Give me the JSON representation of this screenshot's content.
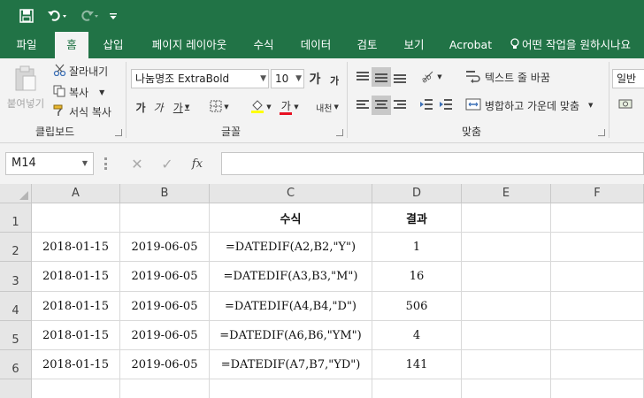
{
  "titlebar": {
    "save_icon": "save-icon",
    "undo_icon": "undo-icon",
    "redo_icon": "redo-icon",
    "customize_icon": "customize-quick-access-icon",
    "bg_color": "#217346"
  },
  "tabs": [
    {
      "label": "파일"
    },
    {
      "label": "홈"
    },
    {
      "label": "삽입"
    },
    {
      "label": "페이지 레이아웃"
    },
    {
      "label": "수식"
    },
    {
      "label": "데이터"
    },
    {
      "label": "검토"
    },
    {
      "label": "보기"
    },
    {
      "label": "Acrobat"
    },
    {
      "label": "어떤 작업을 원하시나요"
    }
  ],
  "active_tab": "홈",
  "ribbon": {
    "clipboard": {
      "paste_label": "붙여넣기",
      "cut_label": "잘라내기",
      "copy_label": "복사",
      "format_painter_label": "서식 복사",
      "group_label": "클립보드"
    },
    "font": {
      "font_name": "나눔명조 ExtraBold",
      "font_size": "10",
      "bold_label": "가",
      "italic_label": "가",
      "underline_label": "가",
      "grow_label": "가",
      "shrink_label": "가",
      "color_label": "가",
      "phonetic_label": "내천",
      "group_label": "글꼴"
    },
    "alignment": {
      "wrap_text_label": "텍스트 줄 바꿈",
      "merge_center_label": "병합하고 가운데 맞춤",
      "group_label": "맞춤"
    },
    "number": {
      "format_value": "일반"
    }
  },
  "formula_bar": {
    "name_box": "M14",
    "cancel_icon": "cancel-icon",
    "enter_icon": "check-icon",
    "fx_label": "fx",
    "formula": ""
  },
  "sheet": {
    "columns": [
      "A",
      "B",
      "C",
      "D",
      "E",
      "F"
    ],
    "rows": [
      {
        "num": "1",
        "cells": [
          "",
          "",
          "수식",
          "결과",
          "",
          ""
        ]
      },
      {
        "num": "2",
        "cells": [
          "2018-01-15",
          "2019-06-05",
          "=DATEDIF(A2,B2,\"Y\")",
          "1",
          "",
          ""
        ]
      },
      {
        "num": "3",
        "cells": [
          "2018-01-15",
          "2019-06-05",
          "=DATEDIF(A3,B3,\"M\")",
          "16",
          "",
          ""
        ]
      },
      {
        "num": "4",
        "cells": [
          "2018-01-15",
          "2019-06-05",
          "=DATEDIF(A4,B4,\"D\")",
          "506",
          "",
          ""
        ]
      },
      {
        "num": "5",
        "cells": [
          "2018-01-15",
          "2019-06-05",
          "=DATEDIF(A6,B6,\"YM\")",
          "4",
          "",
          ""
        ]
      },
      {
        "num": "6",
        "cells": [
          "2018-01-15",
          "2019-06-05",
          "=DATEDIF(A7,B7,\"YD\")",
          "141",
          "",
          ""
        ]
      },
      {
        "num": "",
        "cells": [
          "",
          "",
          "",
          "",
          "",
          ""
        ]
      }
    ]
  }
}
